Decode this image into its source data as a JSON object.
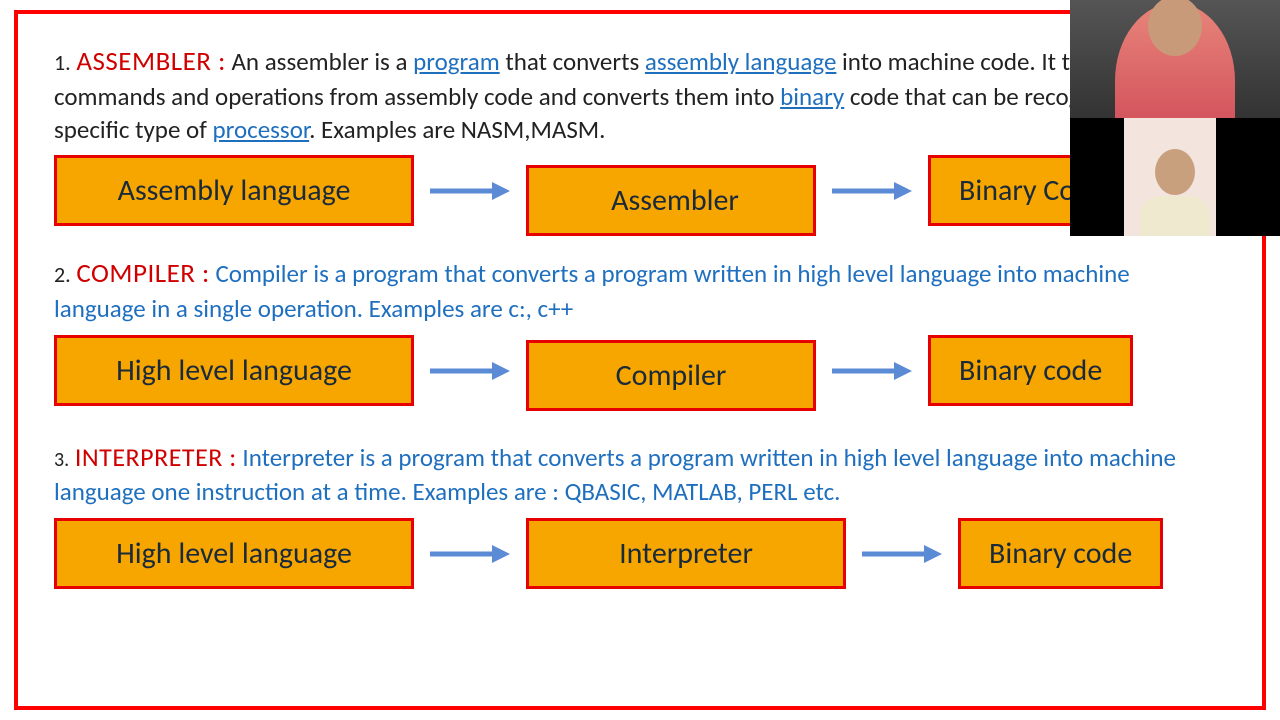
{
  "section1": {
    "num": "1.",
    "heading": "ASSEMBLER :",
    "text_a": " An assembler is a ",
    "link_program": "program",
    "text_b": " that converts ",
    "link_assembly": "assembly language",
    "text_c": " into machine code. It takes the basic commands and operations from assembly code and converts them into ",
    "link_binary": "binary",
    "text_d": " code that can be recognized by a specific type of ",
    "link_processor": "processor",
    "text_e": ". Examples are NASM,MASM.",
    "box1": "Assembly language",
    "box2": "Assembler",
    "box3": "Binary Code"
  },
  "section2": {
    "num": "2.",
    "heading": "COMPILER :",
    "text": " Compiler is a program that converts a program written in high level language into machine language in a single operation. Examples are c:, c++",
    "box1": "High level language",
    "box2": "Compiler",
    "box3": "Binary code"
  },
  "section3": {
    "num": "3.",
    "heading": "INTERPRETER :",
    "text": " Interpreter is a program that converts a program written in high level language into machine language one instruction at a time. Examples are : QBASIC, MATLAB, PERL etc.",
    "box1": "High level language",
    "box2": "Interpreter",
    "box3": "Binary code"
  }
}
